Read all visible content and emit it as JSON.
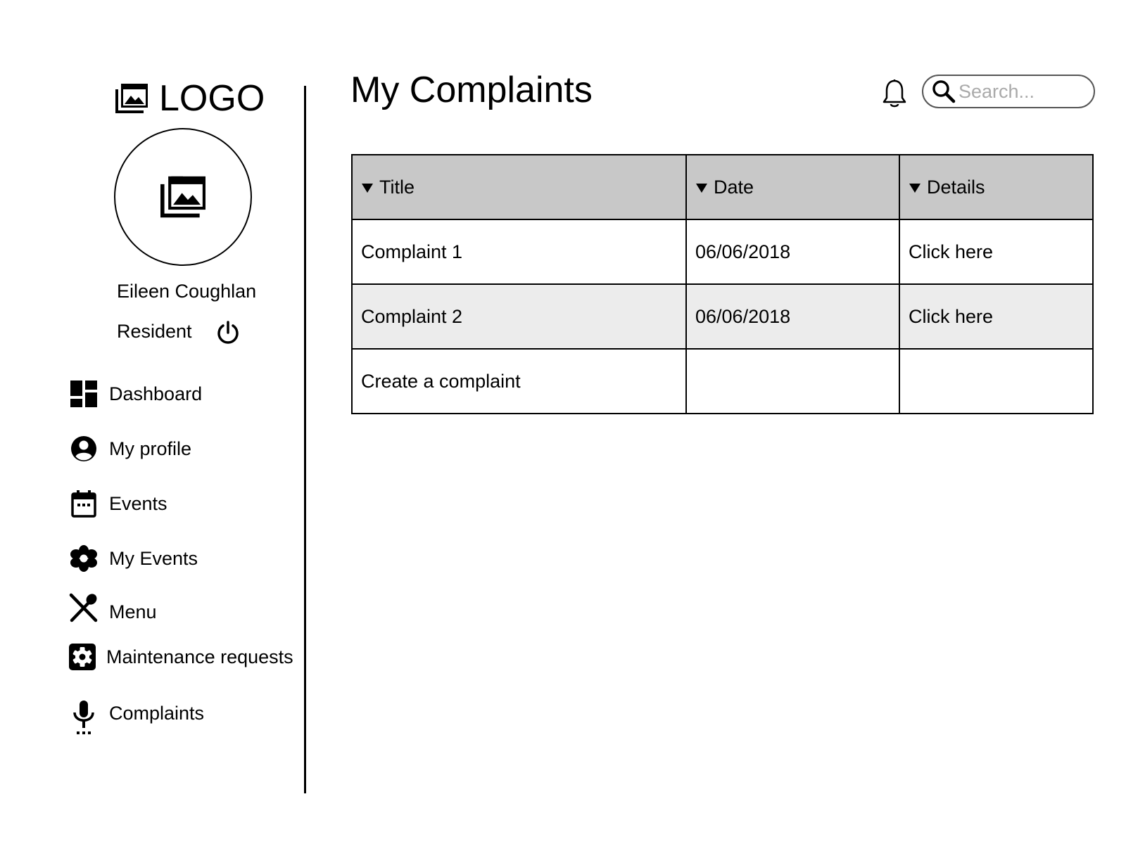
{
  "brand": {
    "logo_text": "LOGO"
  },
  "user": {
    "name": "Eileen Coughlan",
    "role": "Resident"
  },
  "nav": {
    "items": [
      {
        "label": "Dashboard",
        "icon": "dashboard-icon"
      },
      {
        "label": "My profile",
        "icon": "account-circle-icon"
      },
      {
        "label": "Events",
        "icon": "calendar-icon"
      },
      {
        "label": "My Events",
        "icon": "flower-icon"
      },
      {
        "label": "Menu",
        "icon": "utensils-icon"
      },
      {
        "label": "Maintenance requests",
        "icon": "settings-box-icon"
      },
      {
        "label": "Complaints",
        "icon": "microphone-icon"
      }
    ]
  },
  "header": {
    "title": "My Complaints",
    "search_placeholder": "Search..."
  },
  "table": {
    "columns": [
      "Title",
      "Date",
      "Details"
    ],
    "rows": [
      {
        "title": "Complaint 1",
        "date": "06/06/2018",
        "details": "Click here"
      },
      {
        "title": "Complaint 2",
        "date": "06/06/2018",
        "details": "Click here"
      }
    ],
    "create_label": "Create a complaint"
  }
}
